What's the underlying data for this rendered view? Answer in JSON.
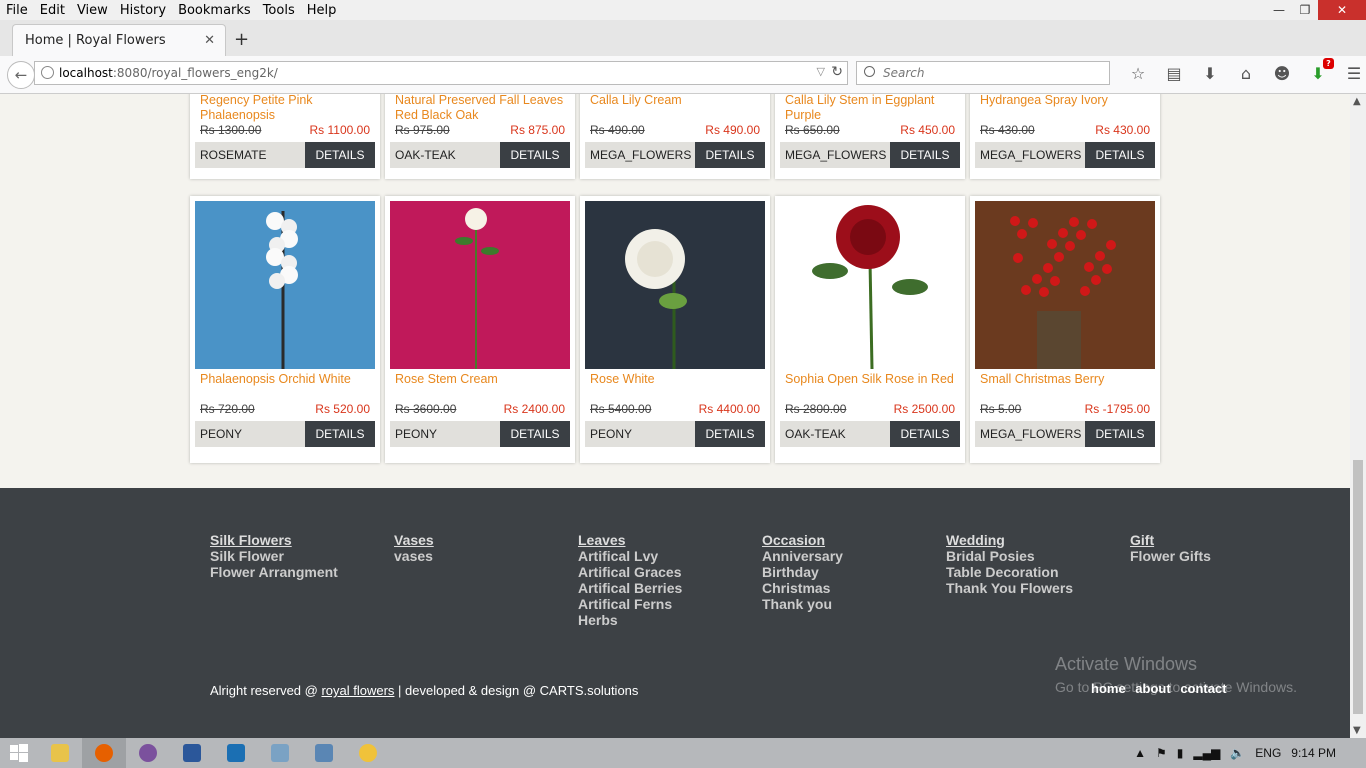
{
  "menubar": [
    "File",
    "Edit",
    "View",
    "History",
    "Bookmarks",
    "Tools",
    "Help"
  ],
  "tab": {
    "title": "Home | Royal Flowers"
  },
  "url": {
    "host": "localhost",
    "rest": ":8080/royal_flowers_eng2k/"
  },
  "search": {
    "placeholder": "Search"
  },
  "download_badge": "?",
  "products_top": [
    {
      "name": "Regency Petite Pink Phalaenopsis",
      "old_price": "Rs 1300.00",
      "new_price": "Rs 1100.00",
      "vendor": "ROSEMATE",
      "details": "DETAILS"
    },
    {
      "name": "Natural Preserved Fall Leaves Red Black Oak",
      "old_price": "Rs 975.00",
      "new_price": "Rs 875.00",
      "vendor": "OAK-TEAK",
      "details": "DETAILS"
    },
    {
      "name": "Calla Lily Cream",
      "old_price": "Rs 490.00",
      "new_price": "Rs 490.00",
      "vendor": "MEGA_FLOWERS",
      "details": "DETAILS"
    },
    {
      "name": "Calla Lily Stem in Eggplant Purple",
      "old_price": "Rs 650.00",
      "new_price": "Rs 450.00",
      "vendor": "MEGA_FLOWERS",
      "details": "DETAILS"
    },
    {
      "name": "Hydrangea Spray Ivory",
      "old_price": "Rs 430.00",
      "new_price": "Rs 430.00",
      "vendor": "MEGA_FLOWERS",
      "details": "DETAILS"
    }
  ],
  "products_bottom": [
    {
      "name": "Phalaenopsis Orchid White",
      "old_price": "Rs 720.00",
      "new_price": "Rs 520.00",
      "vendor": "PEONY",
      "details": "DETAILS",
      "bg": "#4a93c7"
    },
    {
      "name": "Rose Stem Cream",
      "old_price": "Rs 3600.00",
      "new_price": "Rs 2400.00",
      "vendor": "PEONY",
      "details": "DETAILS",
      "bg": "#c0195a"
    },
    {
      "name": "Rose White",
      "old_price": "Rs 5400.00",
      "new_price": "Rs 4400.00",
      "vendor": "PEONY",
      "details": "DETAILS",
      "bg": "#2b3440"
    },
    {
      "name": "Sophia Open Silk Rose in Red",
      "old_price": "Rs 2800.00",
      "new_price": "Rs 2500.00",
      "vendor": "OAK-TEAK",
      "details": "DETAILS",
      "bg": "#ffffff"
    },
    {
      "name": "Small Christmas Berry",
      "old_price": "Rs 5.00",
      "new_price": "Rs -1795.00",
      "vendor": "MEGA_FLOWERS",
      "details": "DETAILS",
      "bg": "#6b3a1f"
    }
  ],
  "footer": {
    "columns": [
      {
        "head": "Silk Flowers",
        "items": [
          "Silk Flower",
          "Flower Arrangment"
        ]
      },
      {
        "head": "Vases",
        "items": [
          "vases"
        ]
      },
      {
        "head": "Leaves",
        "items": [
          "Artifical Lvy",
          "Artifical Graces",
          "Artifical Berries",
          "Artifical Ferns",
          "Herbs"
        ]
      },
      {
        "head": "Occasion",
        "items": [
          "Anniversary",
          "Birthday",
          "Christmas",
          "Thank you"
        ]
      },
      {
        "head": "Wedding",
        "items": [
          "Bridal Posies",
          "Table Decoration",
          "Thank You Flowers"
        ]
      },
      {
        "head": "Gift",
        "items": [
          "Flower Gifts"
        ]
      }
    ],
    "copyright_prefix": "Alright reserved @ ",
    "copyright_link": "royal flowers",
    "copyright_suffix": " | developed & design @ CARTS.solutions",
    "links": [
      "home",
      "about",
      "contact"
    ]
  },
  "activate": {
    "line1": "Activate Windows",
    "line2": "Go to PC settings to activate Windows."
  },
  "tray": {
    "lang": "ENG",
    "time": "9:14 PM"
  },
  "colors": {
    "accent": "#e8881e",
    "price_red": "#d9361c",
    "footer_bg": "#3d4145",
    "button_dark": "#3a3f44"
  }
}
